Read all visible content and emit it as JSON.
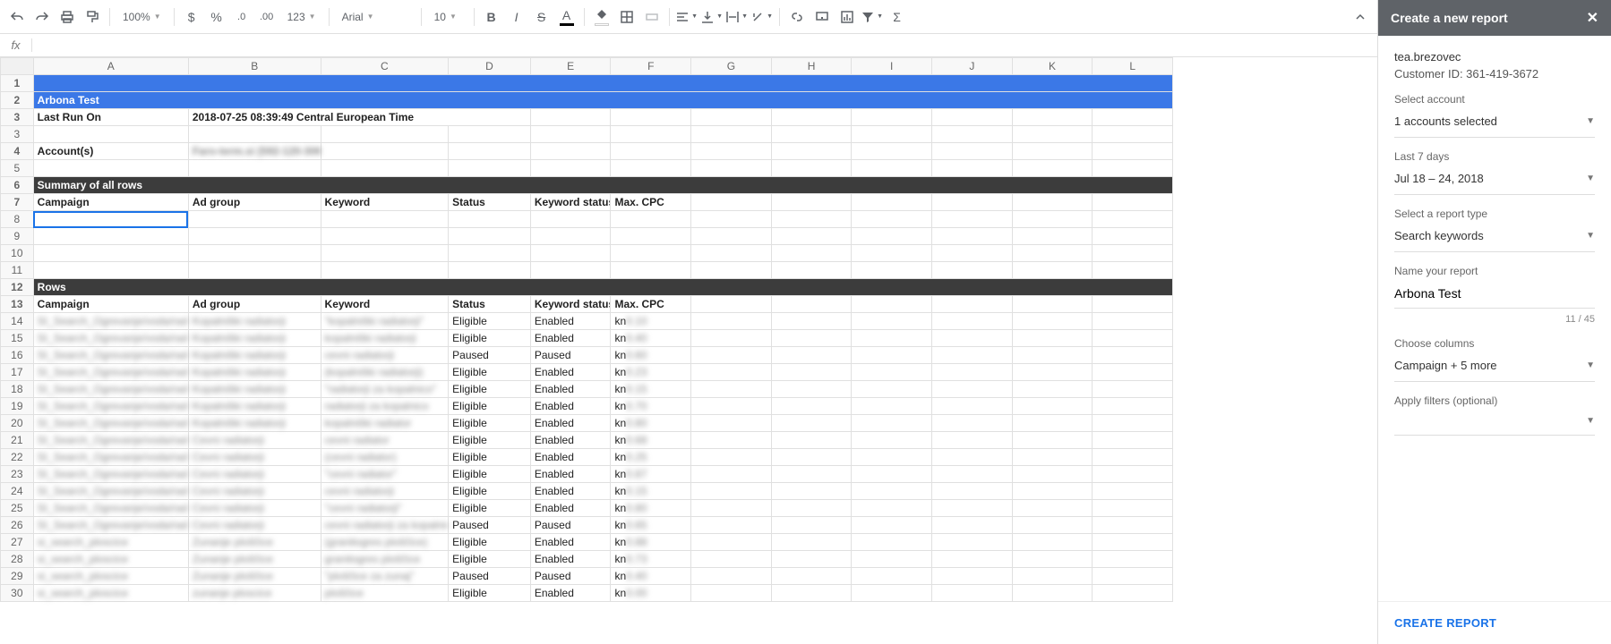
{
  "toolbar": {
    "zoom": "100%",
    "font": "Arial",
    "font_size": "10",
    "currency": "$",
    "percent": "%",
    "dec_dec": ".0",
    "dec_inc": ".00",
    "more_formats": "123"
  },
  "formula_bar": {
    "label": "fx",
    "value": ""
  },
  "columns": [
    "A",
    "B",
    "C",
    "D",
    "E",
    "F",
    "G",
    "H",
    "I",
    "J",
    "K",
    "L"
  ],
  "sheet": {
    "title": "Arbona Test",
    "meta": {
      "last_run_label": "Last Run On",
      "last_run_value": "2018-07-25 08:39:49 Central European Time",
      "accounts_label": "Account(s)",
      "accounts_value": "Faro-term.si (592-120-3062)"
    },
    "summary_header": "Summary of all rows",
    "rows_header": "Rows",
    "col_headers": {
      "campaign": "Campaign",
      "adgroup": "Ad group",
      "keyword": "Keyword",
      "status": "Status",
      "kw_status": "Keyword status",
      "max_cpc": "Max. CPC"
    },
    "data": [
      {
        "campaign": "SI_Search_Ogrevanje/voda/radiatorji",
        "adgroup": "Kopalniški radiatorji",
        "keyword": "\"kopalniški radiatorji\"",
        "status": "Eligible",
        "kw_status": "Enabled",
        "cpc": "kn0.10"
      },
      {
        "campaign": "SI_Search_Ogrevanje/voda/radiatorji",
        "adgroup": "Kopalniški radiatorji",
        "keyword": "kopalniški radiatorji",
        "status": "Eligible",
        "kw_status": "Enabled",
        "cpc": "kn0.40"
      },
      {
        "campaign": "SI_Search_Ogrevanje/voda/radiatorji",
        "adgroup": "Kopalniški radiatorji",
        "keyword": "cevni radiatorji",
        "status": "Paused",
        "kw_status": "Paused",
        "cpc": "kn0.60"
      },
      {
        "campaign": "SI_Search_Ogrevanje/voda/radiatorji",
        "adgroup": "Kopalniški radiatorji",
        "keyword": "(kopalniški radiatorji)",
        "status": "Eligible",
        "kw_status": "Enabled",
        "cpc": "kn0.23"
      },
      {
        "campaign": "SI_Search_Ogrevanje/voda/radiatorji",
        "adgroup": "Kopalniški radiatorji",
        "keyword": "\"radiatorji za kopalnico\"",
        "status": "Eligible",
        "kw_status": "Enabled",
        "cpc": "kn0.15"
      },
      {
        "campaign": "SI_Search_Ogrevanje/voda/radiatorji",
        "adgroup": "Kopalniški radiatorji",
        "keyword": "radiatorji za kopalnico",
        "status": "Eligible",
        "kw_status": "Enabled",
        "cpc": "kn0.70"
      },
      {
        "campaign": "SI_Search_Ogrevanje/voda/radiatorji",
        "adgroup": "Kopalniški radiatorji",
        "keyword": "kopalniški radiator",
        "status": "Eligible",
        "kw_status": "Enabled",
        "cpc": "kn0.80"
      },
      {
        "campaign": "SI_Search_Ogrevanje/voda/radiatorji",
        "adgroup": "Cevni radiatorji",
        "keyword": "cevni radiator",
        "status": "Eligible",
        "kw_status": "Enabled",
        "cpc": "kn0.68"
      },
      {
        "campaign": "SI_Search_Ogrevanje/voda/radiatorji",
        "adgroup": "Cevni radiatorji",
        "keyword": "(cevni radiator)",
        "status": "Eligible",
        "kw_status": "Enabled",
        "cpc": "kn0.25"
      },
      {
        "campaign": "SI_Search_Ogrevanje/voda/radiatorji",
        "adgroup": "Cevni radiatorji",
        "keyword": "\"cevni radiator\"",
        "status": "Eligible",
        "kw_status": "Enabled",
        "cpc": "kn0.87"
      },
      {
        "campaign": "SI_Search_Ogrevanje/voda/radiatorji",
        "adgroup": "Cevni radiatorji",
        "keyword": "cevni radiatorji",
        "status": "Eligible",
        "kw_status": "Enabled",
        "cpc": "kn0.15"
      },
      {
        "campaign": "SI_Search_Ogrevanje/voda/radiatorji",
        "adgroup": "Cevni radiatorji",
        "keyword": "\"cevni radiatorji\"",
        "status": "Eligible",
        "kw_status": "Enabled",
        "cpc": "kn0.80"
      },
      {
        "campaign": "SI_Search_Ogrevanje/voda/radiatorji",
        "adgroup": "Cevni radiatorji",
        "keyword": "cevni radiatorji za kopalnico",
        "status": "Paused",
        "kw_status": "Paused",
        "cpc": "kn0.65"
      },
      {
        "campaign": "si_search_ploscice",
        "adgroup": "Zunanje ploščice",
        "keyword": "(granitogres ploščice)",
        "status": "Eligible",
        "kw_status": "Enabled",
        "cpc": "kn0.88"
      },
      {
        "campaign": "si_search_ploscice",
        "adgroup": "Zunanje ploščice",
        "keyword": "granitogres ploščice",
        "status": "Eligible",
        "kw_status": "Enabled",
        "cpc": "kn0.73"
      },
      {
        "campaign": "si_search_ploscice",
        "adgroup": "Zunanje ploščice",
        "keyword": "\"ploščice za zunaj\"",
        "status": "Paused",
        "kw_status": "Paused",
        "cpc": "kn0.40"
      },
      {
        "campaign": "si_search_ploscice",
        "adgroup": "zunanje ploscice",
        "keyword": "ploščice",
        "status": "Eligible",
        "kw_status": "Enabled",
        "cpc": "kn0.00"
      }
    ]
  },
  "sidebar": {
    "title": "Create a new report",
    "user": "tea.brezovec",
    "customer_id_label": "Customer ID: 361-419-3672",
    "select_account_label": "Select account",
    "accounts_selected": "1 accounts selected",
    "date_preset_label": "Last 7 days",
    "date_range": "Jul 18 – 24, 2018",
    "report_type_label": "Select a report type",
    "report_type": "Search keywords",
    "name_label": "Name your report",
    "name_value": "Arbona Test",
    "char_count": "11 / 45",
    "columns_label": "Choose columns",
    "columns_value": "Campaign + 5 more",
    "filters_label": "Apply filters (optional)",
    "create_label": "CREATE REPORT"
  }
}
